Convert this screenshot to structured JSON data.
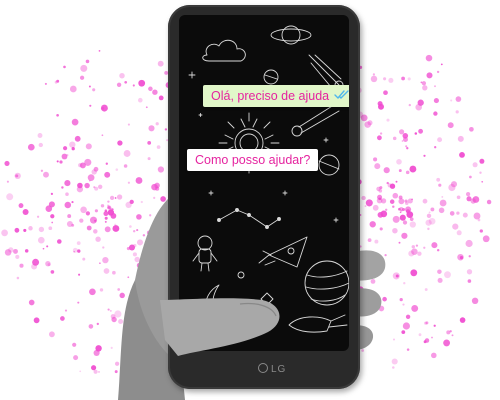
{
  "chat": {
    "outgoing_message": "Olá, preciso de ajuda",
    "incoming_message": "Como posso ajudar?",
    "read_status_icon": "double-check-icon"
  },
  "device": {
    "brand": "LG"
  },
  "colors": {
    "message_text": "#e5239f",
    "outgoing_bubble": "#e1f7c9",
    "incoming_bubble": "#ffffff",
    "check_mark": "#4fb6ec",
    "confetti": "#f04bd0",
    "screen_background": "#0b0b0b"
  }
}
